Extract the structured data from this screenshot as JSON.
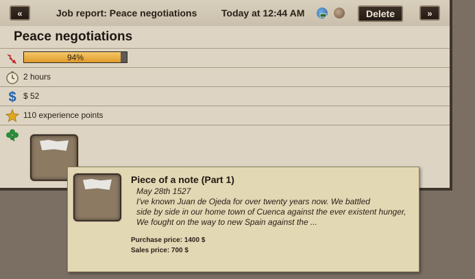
{
  "header": {
    "prev_label": "«",
    "title": "Job report: Peace negotiations",
    "time": "Today at 12:44 AM",
    "delete_label": "Delete",
    "next_label": "»"
  },
  "job": {
    "name": "Peace negotiations",
    "progress_label": "94%",
    "progress_fraction": 0.94,
    "duration": "2 hours",
    "money": "$ 52",
    "experience": "110 experience points"
  },
  "item_tooltip": {
    "title": "Piece of a note (Part 1)",
    "lines": [
      "May 28th 1527",
      "I've known Juan de Ojeda for over twenty years now. We battled",
      "side by side in our home town of Cuenca against the ever existent hunger,",
      "We fought on the way to new Spain against the ..."
    ],
    "purchase_price": "Purchase price: 1400 $",
    "sales_price": "Sales price: 700 $"
  },
  "colors": {
    "progress": "#e9a23a",
    "dollar": "#1f5fb0",
    "star": "#e0a81e",
    "clover": "#2e8b3a",
    "motivation": "#c0282a"
  },
  "icons": {
    "motivation": "motivation-icon",
    "duration": "stopwatch-icon",
    "money": "dollar-icon",
    "experience": "star-icon",
    "luck": "clover-icon"
  }
}
